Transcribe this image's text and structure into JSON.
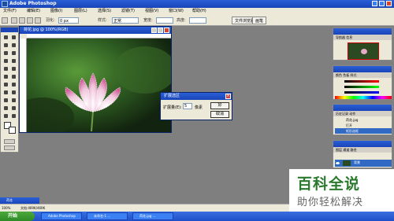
{
  "app": {
    "title": "Adobe Photoshop"
  },
  "menubar": {
    "items": [
      "文件(F)",
      "编辑(E)",
      "图像(I)",
      "图层(L)",
      "选择(S)",
      "滤镜(T)",
      "视图(V)",
      "窗口(W)",
      "帮助(H)"
    ]
  },
  "options_bar": {
    "feather_label": "羽化:",
    "feather_value": "0 px",
    "style_label": "样式:",
    "style_value": "正常",
    "width_label": "宽度:",
    "height_label": "高度:",
    "tab_file_browser": "文件浏览器",
    "tab_brushes": "画笔"
  },
  "document": {
    "title": "荷花.jpg @ 100%(RGB)"
  },
  "dialog": {
    "title": "扩展选区",
    "amount_label": "扩展量(E):",
    "amount_value": "5",
    "unit": "像素",
    "ok": "好",
    "cancel": "取消"
  },
  "panels": {
    "navigator": {
      "tabs": "导航器 信息"
    },
    "color": {
      "tabs": "颜色 色板 样式"
    },
    "history": {
      "tabs": "历史记录 动作",
      "items": [
        "荷花.jpg",
        "打开",
        "矩形选框"
      ]
    },
    "layers": {
      "tabs": "图层 通道 路径",
      "layer_name": "背景"
    }
  },
  "mini_window": {
    "title": "荷花"
  },
  "statusbar": {
    "zoom": "100%",
    "doc": "文档:469K/469K"
  },
  "taskbar": {
    "start": "开始",
    "tasks": [
      "Adobe Photoshop",
      "未命名-1 ...",
      "荷花.jpg ..."
    ]
  },
  "watermark": {
    "title": "百科全说",
    "subtitle": "助你轻松解决"
  },
  "colors": {
    "title_blue": "#1a44b8",
    "xp_beige": "#ece9d8",
    "taskbar_blue": "#245edb",
    "brand_green": "#2a7a2e"
  }
}
